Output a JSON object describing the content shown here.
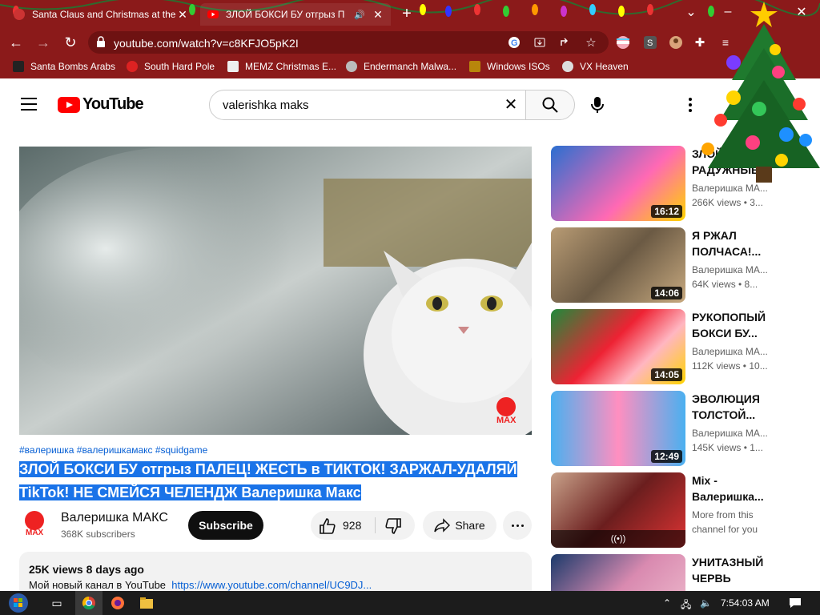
{
  "browser": {
    "tabs": [
      {
        "title": "Santa Claus and Christmas at the",
        "active": false
      },
      {
        "title": "ЗЛОЙ БОКСИ БУ отгрыз П",
        "active": true
      }
    ],
    "url": "youtube.com/watch?v=c8KFJO5pK2I",
    "bookmarks": [
      {
        "label": "Santa Bombs Arabs"
      },
      {
        "label": "South Hard Pole"
      },
      {
        "label": "MEMZ Christmas E..."
      },
      {
        "label": "Endermanch Malwa..."
      },
      {
        "label": "Windows ISOs"
      },
      {
        "label": "VX Heaven"
      }
    ],
    "colors": {
      "chrome": "#8b1a1a",
      "omnibox": "#6e1212"
    }
  },
  "youtube": {
    "logo_text": "YouTube",
    "search_query": "valerishka maks",
    "video": {
      "hashtags": "#валеришка #валеришкамакс #squidgame",
      "title": "ЗЛОЙ БОКСИ БУ отгрыз ПАЛЕЦ! ЖЕСТЬ в ТИКТОК! ЗАРЖАЛ-УДАЛЯЙ TikTok! НЕ СМЕЙСЯ ЧЕЛЕНДЖ Валеришка Макс",
      "channel_name": "Валеришка МАКС",
      "subscribers": "368K subscribers",
      "subscribe_label": "Subscribe",
      "likes": "928",
      "share_label": "Share",
      "stats": "25K views  8 days ago",
      "description_text": "Мой новый канал в YouTube",
      "description_link": "https://www.youtube.com/channel/UC9DJ..."
    },
    "recommendations": [
      {
        "title": "ЗЛОЙ РАДУЖНЫЕ",
        "channel": "Валеришка МА...",
        "meta": "266K views • 3...",
        "duration": "16:12"
      },
      {
        "title": "Я РЖАЛ ПОЛЧАСА!...",
        "channel": "Валеришка МА...",
        "meta": "64K views • 8...",
        "duration": "14:06"
      },
      {
        "title": "РУКОПОПЫЙ БОКСИ БУ...",
        "channel": "Валеришка МА...",
        "meta": "112K views • 10...",
        "duration": "14:05"
      },
      {
        "title": "ЭВОЛЮЦИЯ ТОЛСТОЙ...",
        "channel": "Валеришка МА...",
        "meta": "145K views • 1...",
        "duration": "12:49"
      },
      {
        "title": "Mix - Валеришка...",
        "channel": "More from this",
        "meta": "channel for you",
        "duration": "((•))"
      },
      {
        "title": "УНИТАЗНЫЙ ЧЕРВЬ СЪЕЛ...",
        "channel": "",
        "meta": "",
        "duration": ""
      }
    ]
  },
  "taskbar": {
    "clock": "7:54:03 AM"
  }
}
